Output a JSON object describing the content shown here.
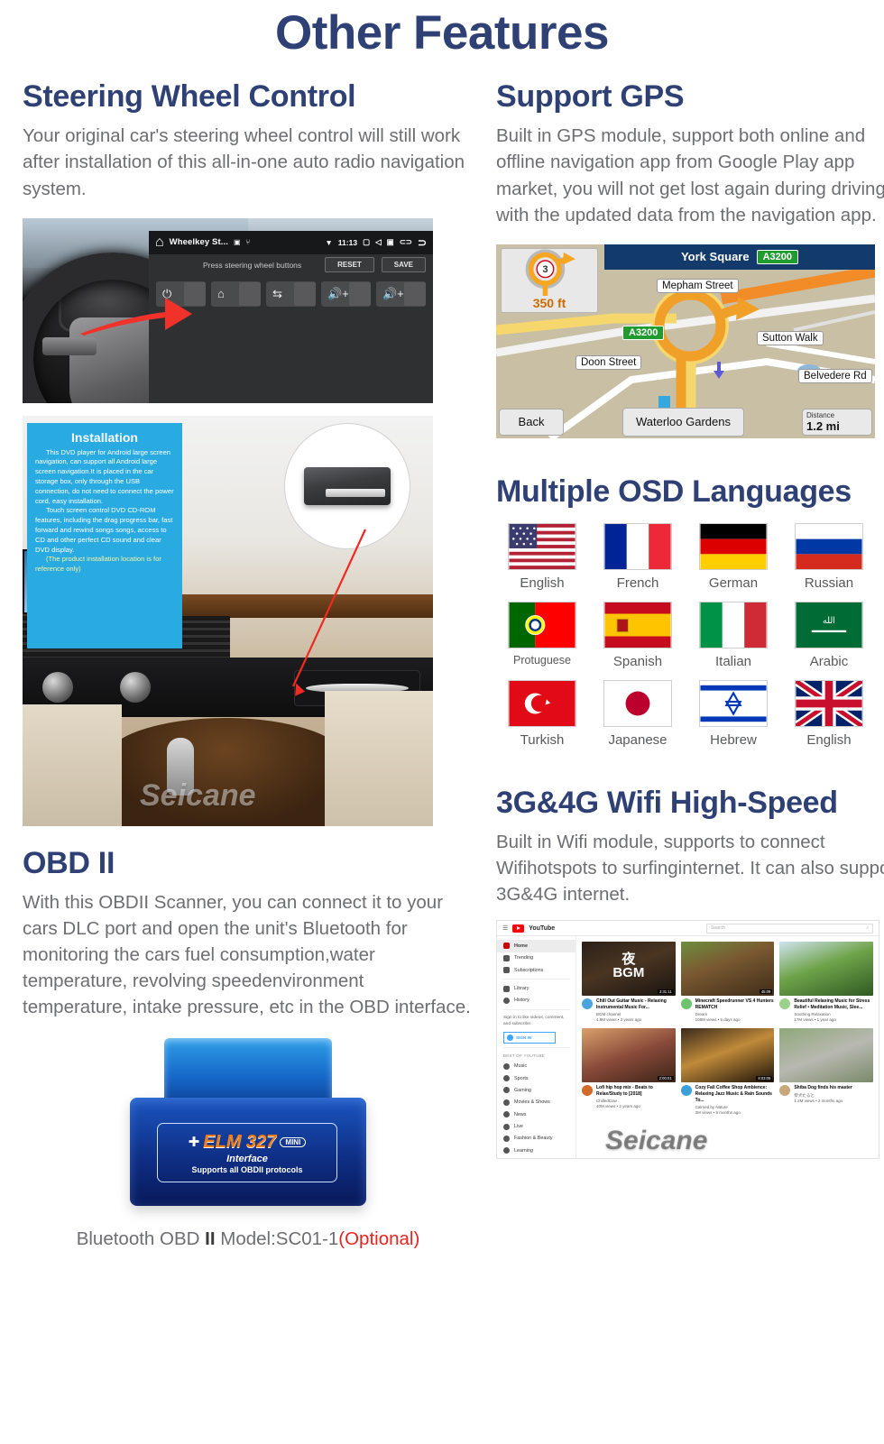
{
  "page": {
    "title": "Other Features"
  },
  "sections": {
    "steering": {
      "heading": "Steering Wheel Control",
      "body": "Your original car's steering wheel control will still work after installation of this all-in-one auto radio navigation system.",
      "screen": {
        "app_title": "Wheelkey St...",
        "clock": "11:13",
        "hint": "Press steering wheel buttons",
        "reset_label": "RESET",
        "save_label": "SAVE",
        "keys": [
          "power-icon",
          "home-icon",
          "back-icon",
          "volume-up-icon",
          "volume-down-icon"
        ]
      }
    },
    "gps": {
      "heading": "Support GPS",
      "body": "Built in GPS module, support both online and offline navigation app from Google Play app market, you will not get lost again during driving with the updated data from the navigation app.",
      "map": {
        "header_street": "York Square",
        "header_road_badge": "A3200",
        "turn_exit_number": "3",
        "turn_distance": "350 ft",
        "road_badge": "A3200",
        "labels": [
          "Mepham Street",
          "Sutton Walk",
          "Doon Street",
          "Belvedere Rd"
        ],
        "back_label": "Back",
        "destination": "Waterloo Gardens",
        "distance_label": "Distance",
        "distance_value": "1.2 mi"
      }
    },
    "installation": {
      "box_title": "Installation",
      "paragraph1": "This DVD player for Android large screen navigation, can support all Android large screen navigation.It is placed in the car storage box, only through the USB connection, do not need to connect the power cord, easy installation.",
      "paragraph2": "Touch screen control DVD CD-ROM features, including the drag progress bar, fast forward and rewind songs songs, access to CD and other perfect CD sound and clear DVD display.",
      "note": "(The product installation location is for reference only)",
      "watermark": "Seicane"
    },
    "osd": {
      "heading": "Multiple OSD Languages",
      "languages": [
        {
          "label": "English",
          "flag": "us"
        },
        {
          "label": "French",
          "flag": "fr"
        },
        {
          "label": "German",
          "flag": "de"
        },
        {
          "label": "Russian",
          "flag": "ru"
        },
        {
          "label": "Protuguese",
          "flag": "pt"
        },
        {
          "label": "Spanish",
          "flag": "es"
        },
        {
          "label": "Italian",
          "flag": "it"
        },
        {
          "label": "Arabic",
          "flag": "sa"
        },
        {
          "label": "Turkish",
          "flag": "tr"
        },
        {
          "label": "Japanese",
          "flag": "jp"
        },
        {
          "label": "Hebrew",
          "flag": "il"
        },
        {
          "label": "English",
          "flag": "gb"
        }
      ]
    },
    "obd": {
      "heading": "OBD II",
      "body": "With this OBDII Scanner, you can connect it to your cars DLC port and open the unit's Bluetooth for monitoring the cars fuel consumption,water temperature, revolving speedenvironment temperature, intake pressure, etc in the OBD interface.",
      "device": {
        "brand": "ELM 327",
        "mini": "MINI",
        "interface": "Interface",
        "protocols": "Supports all OBDII protocols"
      },
      "caption_prefix": "Bluetooth OBD ",
      "caption_mark": "II",
      "caption_model": " Model:SC01-1",
      "caption_optional": "(Optional)"
    },
    "wifi": {
      "heading": "3G&4G Wifi High-Speed",
      "body": "Built in Wifi module, supports to connect  Wifihotspots to surfinginternet. It can also support 3G&4G internet.",
      "youtube": {
        "wordmark": "YouTube",
        "search_placeholder": "Search",
        "nav": [
          "Home",
          "Trending",
          "Subscriptions",
          "Library",
          "History"
        ],
        "sign_in_prompt": "Sign in to like videos, comment, and subscribe.",
        "sign_in_label": "SIGN IN",
        "category_header": "BEST OF YOUTUBE",
        "categories": [
          "Music",
          "Sports",
          "Gaming",
          "Movies & Shows",
          "News",
          "Live",
          "Fashion & Beauty",
          "Learning"
        ],
        "videos": [
          {
            "title": "Chill Out Guitar Music - Relaxing Instrumental Music For...",
            "channel": "BGM channel",
            "views": "4.8M views • 3 years ago",
            "duration": "3:31:11",
            "overlay": "夜 BGM"
          },
          {
            "title": "Minecraft Speedrunner VS 4 Hunters REMATCH",
            "channel": "Dream",
            "views": "108M views • 5 days ago",
            "duration": "45:09",
            "overlay": ""
          },
          {
            "title": "Beautiful Relaxing Music for Stress Relief • Meditation Music, Slee...",
            "channel": "Soothing Relaxation",
            "views": "17M views • 1 year ago",
            "duration": "",
            "overlay": ""
          },
          {
            "title": "Lofi hip hop mix - Beats to Relax/Study to [2018]",
            "channel": "ChilledCow",
            "views": "40M views • 2 years ago",
            "duration": "2:00:01",
            "overlay": ""
          },
          {
            "title": "Cozy Fall Coffee Shop Ambience: Relaxing Jazz Music & Rain Sounds To...",
            "channel": "Calmed by Nature",
            "views": "3M views • 5 months ago",
            "duration": "8:03:05",
            "overlay": ""
          },
          {
            "title": "Shiba Dog finds his master",
            "channel": "柴犬たると",
            "views": "1.2M views • 2 months ago",
            "duration": "",
            "overlay": ""
          }
        ],
        "watermark": "Seicane"
      }
    }
  },
  "colors": {
    "brand_blue": "#2e4074",
    "body_gray": "#6d6e71",
    "optional_red": "#e8231f",
    "install_blue": "#29abe2"
  }
}
